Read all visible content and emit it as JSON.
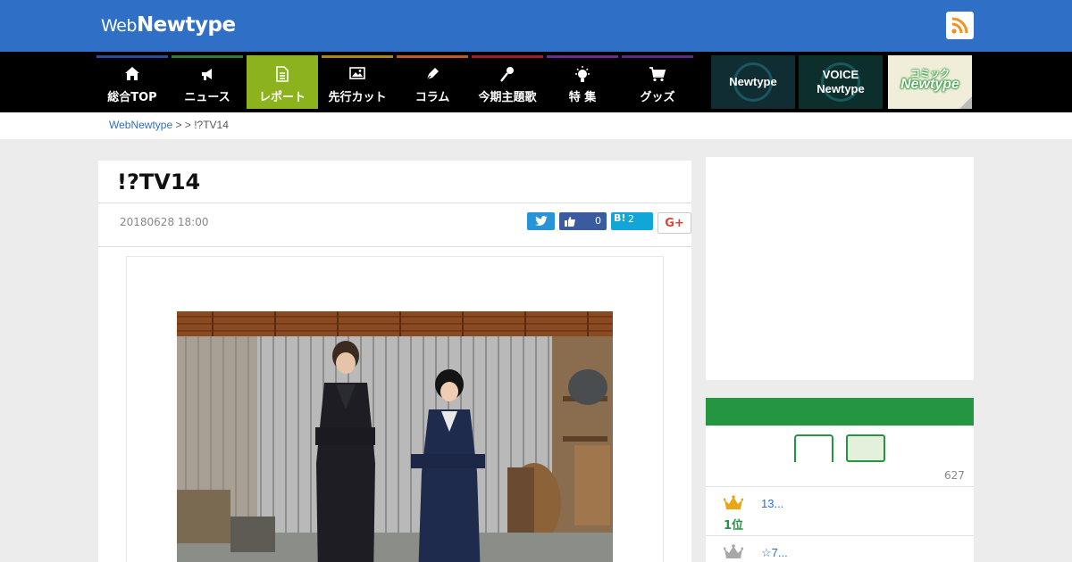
{
  "header": {
    "logo_web": "Web",
    "logo_newtype": "Newtype",
    "rss_icon": "rss-icon",
    "color": "#2f6fc6"
  },
  "nav": {
    "items": [
      {
        "label": "総合TOP",
        "icon": "home-icon",
        "color": "#2a4b9b"
      },
      {
        "label": "ニュース",
        "icon": "megaphone-icon",
        "color": "#2e7a3c"
      },
      {
        "label": "レポート",
        "icon": "document-icon",
        "color": "#8cb21e",
        "active": true
      },
      {
        "label": "先行カット",
        "icon": "image-icon",
        "color": "#a9871c"
      },
      {
        "label": "コラム",
        "icon": "pen-icon",
        "color": "#c25a26"
      },
      {
        "label": "今期主題歌",
        "icon": "microphone-icon",
        "color": "#9c1e2b"
      },
      {
        "label": "特 集",
        "icon": "lightbulb-icon",
        "color": "#6b2c8e"
      },
      {
        "label": "グッズ",
        "icon": "cart-icon",
        "color": "#5a2a86"
      }
    ],
    "banners": [
      {
        "line1": "Newtype"
      },
      {
        "line1": "VOICE",
        "line2": "Newtype"
      },
      {
        "line1": "コミック",
        "line2": "Newtype"
      }
    ]
  },
  "breadcrumb": {
    "home": "WebNewtype",
    "sep1": " > ",
    "sep2": " > ",
    "current": "!?TV14"
  },
  "article": {
    "title": "!?TV14",
    "date": "20180628 18:00",
    "share": {
      "facebook_count": "0",
      "hatena_label": "B!",
      "hatena_count": "2",
      "googleplus_label": "G+"
    }
  },
  "sidebar": {
    "ranking": {
      "count": "627",
      "items": [
        {
          "rank": "1位",
          "text": "13..."
        },
        {
          "rank": "",
          "text": "☆7..."
        }
      ]
    }
  }
}
